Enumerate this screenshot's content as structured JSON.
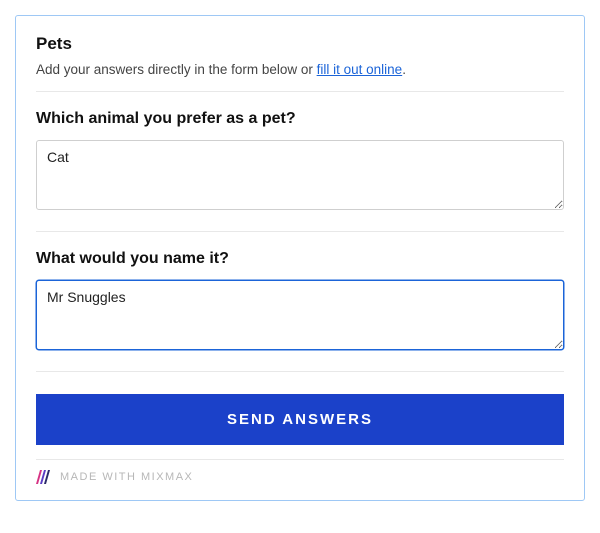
{
  "form": {
    "title": "Pets",
    "subtitle_prefix": "Add your answers directly in the form below or ",
    "subtitle_link": "fill it out online",
    "subtitle_suffix": ".",
    "questions": [
      {
        "label": "Which animal you prefer as a pet?",
        "value": "Cat",
        "focused": false
      },
      {
        "label": "What would you name it?",
        "value": "Mr Snuggles",
        "focused": true
      }
    ],
    "submit_label": "SEND ANSWERS"
  },
  "footer": {
    "made_with": "MADE WITH MIXMAX"
  }
}
